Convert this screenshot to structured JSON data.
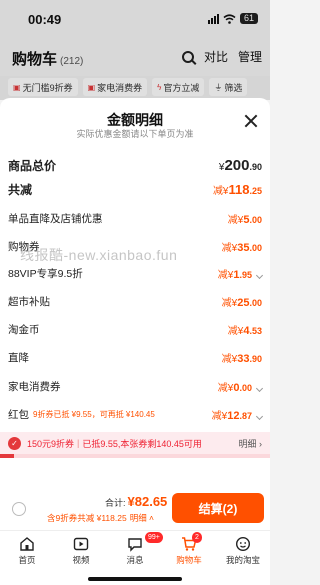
{
  "status": {
    "time": "00:49",
    "battery": "61"
  },
  "header": {
    "title": "购物车",
    "count": "(212)",
    "compare": "对比",
    "manage": "管理"
  },
  "chips": [
    {
      "label": "无门槛9折券",
      "icon": "coupon-icon"
    },
    {
      "label": "家电消费券",
      "icon": "coupon-icon"
    },
    {
      "label": "官方立减",
      "icon": "lightning-icon"
    },
    {
      "label": "筛选",
      "icon": "filter-icon"
    }
  ],
  "sheet": {
    "title": "金额明细",
    "subtitle": "实际优惠金额请以下单页为准",
    "rows": [
      {
        "label": "商品总价",
        "prefix": "¥",
        "int": "200",
        "dec": ".90",
        "type": "total"
      },
      {
        "label": "共减",
        "prefix": "减¥",
        "int": "118",
        "dec": ".25",
        "type": "orange-big"
      },
      {
        "label": "单品直降及店铺优惠",
        "prefix": "减¥",
        "int": "5",
        "dec": ".00",
        "type": "orange"
      },
      {
        "label": "购物券",
        "prefix": "减¥",
        "int": "35",
        "dec": ".00",
        "type": "orange"
      },
      {
        "label": "88VIP专享9.5折",
        "prefix": "减¥",
        "int": "1",
        "dec": ".95",
        "type": "orange",
        "chevron": true
      },
      {
        "label": "超市补贴",
        "prefix": "减¥",
        "int": "25",
        "dec": ".00",
        "type": "orange"
      },
      {
        "label": "淘金币",
        "prefix": "减¥",
        "int": "4",
        "dec": ".53",
        "type": "orange"
      },
      {
        "label": "直降",
        "prefix": "减¥",
        "int": "33",
        "dec": ".90",
        "type": "orange"
      },
      {
        "label": "家电消费券",
        "prefix": "减¥",
        "int": "0",
        "dec": ".00",
        "type": "orange",
        "chevron": true
      },
      {
        "label": "红包",
        "note": "9折券已抵 ¥9.55，可再抵 ¥140.45",
        "prefix": "减¥",
        "int": "12",
        "dec": ".87",
        "type": "orange",
        "chevron": true
      },
      {
        "label": "合计",
        "prefix": "¥",
        "int": "82",
        "dec": ".65",
        "type": "total"
      }
    ]
  },
  "watermark": "线报酷-new.xianbao.fun",
  "promo": {
    "check": "✓",
    "coupon": "150元9折券",
    "sep": "|",
    "used": "已抵9.55,本张券剩140.45可用",
    "more": "明细 ›",
    "progress": 0.05
  },
  "checkout": {
    "sum_label": "合计:",
    "sum_value": "¥82.65",
    "discount": "含9折券共减 ¥118.25",
    "detail": "明细 ˄",
    "settle": "结算(2)"
  },
  "tabs": [
    {
      "label": "首页",
      "icon": "home-icon"
    },
    {
      "label": "视频",
      "icon": "video-icon"
    },
    {
      "label": "消息",
      "icon": "message-icon",
      "badge": "99+"
    },
    {
      "label": "购物车",
      "icon": "cart-icon",
      "badge": "2",
      "active": true
    },
    {
      "label": "我的淘宝",
      "icon": "profile-icon"
    }
  ]
}
